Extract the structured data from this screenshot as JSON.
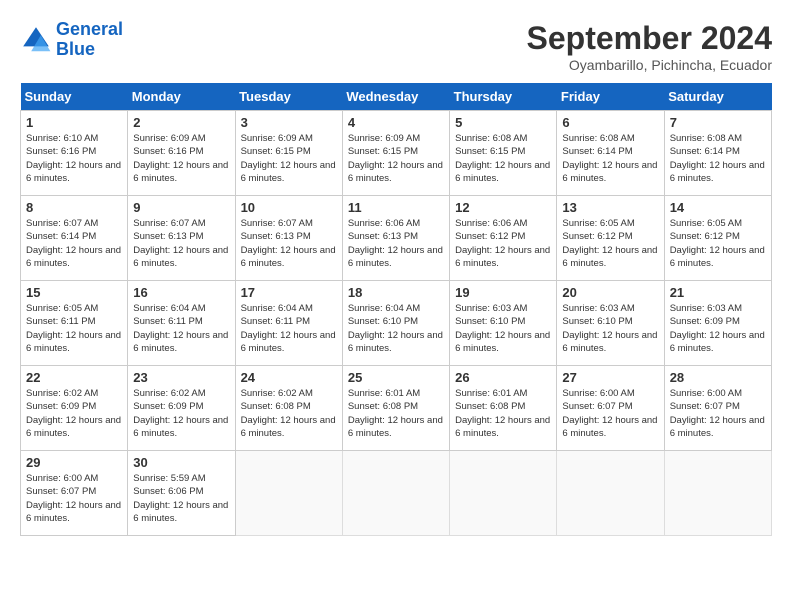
{
  "header": {
    "logo_line1": "General",
    "logo_line2": "Blue",
    "month_year": "September 2024",
    "location": "Oyambarillo, Pichincha, Ecuador"
  },
  "weekdays": [
    "Sunday",
    "Monday",
    "Tuesday",
    "Wednesday",
    "Thursday",
    "Friday",
    "Saturday"
  ],
  "weeks": [
    [
      {
        "day": "1",
        "sunrise": "6:10 AM",
        "sunset": "6:16 PM",
        "daylight": "12 hours and 6 minutes."
      },
      {
        "day": "2",
        "sunrise": "6:09 AM",
        "sunset": "6:16 PM",
        "daylight": "12 hours and 6 minutes."
      },
      {
        "day": "3",
        "sunrise": "6:09 AM",
        "sunset": "6:15 PM",
        "daylight": "12 hours and 6 minutes."
      },
      {
        "day": "4",
        "sunrise": "6:09 AM",
        "sunset": "6:15 PM",
        "daylight": "12 hours and 6 minutes."
      },
      {
        "day": "5",
        "sunrise": "6:08 AM",
        "sunset": "6:15 PM",
        "daylight": "12 hours and 6 minutes."
      },
      {
        "day": "6",
        "sunrise": "6:08 AM",
        "sunset": "6:14 PM",
        "daylight": "12 hours and 6 minutes."
      },
      {
        "day": "7",
        "sunrise": "6:08 AM",
        "sunset": "6:14 PM",
        "daylight": "12 hours and 6 minutes."
      }
    ],
    [
      {
        "day": "8",
        "sunrise": "6:07 AM",
        "sunset": "6:14 PM",
        "daylight": "12 hours and 6 minutes."
      },
      {
        "day": "9",
        "sunrise": "6:07 AM",
        "sunset": "6:13 PM",
        "daylight": "12 hours and 6 minutes."
      },
      {
        "day": "10",
        "sunrise": "6:07 AM",
        "sunset": "6:13 PM",
        "daylight": "12 hours and 6 minutes."
      },
      {
        "day": "11",
        "sunrise": "6:06 AM",
        "sunset": "6:13 PM",
        "daylight": "12 hours and 6 minutes."
      },
      {
        "day": "12",
        "sunrise": "6:06 AM",
        "sunset": "6:12 PM",
        "daylight": "12 hours and 6 minutes."
      },
      {
        "day": "13",
        "sunrise": "6:05 AM",
        "sunset": "6:12 PM",
        "daylight": "12 hours and 6 minutes."
      },
      {
        "day": "14",
        "sunrise": "6:05 AM",
        "sunset": "6:12 PM",
        "daylight": "12 hours and 6 minutes."
      }
    ],
    [
      {
        "day": "15",
        "sunrise": "6:05 AM",
        "sunset": "6:11 PM",
        "daylight": "12 hours and 6 minutes."
      },
      {
        "day": "16",
        "sunrise": "6:04 AM",
        "sunset": "6:11 PM",
        "daylight": "12 hours and 6 minutes."
      },
      {
        "day": "17",
        "sunrise": "6:04 AM",
        "sunset": "6:11 PM",
        "daylight": "12 hours and 6 minutes."
      },
      {
        "day": "18",
        "sunrise": "6:04 AM",
        "sunset": "6:10 PM",
        "daylight": "12 hours and 6 minutes."
      },
      {
        "day": "19",
        "sunrise": "6:03 AM",
        "sunset": "6:10 PM",
        "daylight": "12 hours and 6 minutes."
      },
      {
        "day": "20",
        "sunrise": "6:03 AM",
        "sunset": "6:10 PM",
        "daylight": "12 hours and 6 minutes."
      },
      {
        "day": "21",
        "sunrise": "6:03 AM",
        "sunset": "6:09 PM",
        "daylight": "12 hours and 6 minutes."
      }
    ],
    [
      {
        "day": "22",
        "sunrise": "6:02 AM",
        "sunset": "6:09 PM",
        "daylight": "12 hours and 6 minutes."
      },
      {
        "day": "23",
        "sunrise": "6:02 AM",
        "sunset": "6:09 PM",
        "daylight": "12 hours and 6 minutes."
      },
      {
        "day": "24",
        "sunrise": "6:02 AM",
        "sunset": "6:08 PM",
        "daylight": "12 hours and 6 minutes."
      },
      {
        "day": "25",
        "sunrise": "6:01 AM",
        "sunset": "6:08 PM",
        "daylight": "12 hours and 6 minutes."
      },
      {
        "day": "26",
        "sunrise": "6:01 AM",
        "sunset": "6:08 PM",
        "daylight": "12 hours and 6 minutes."
      },
      {
        "day": "27",
        "sunrise": "6:00 AM",
        "sunset": "6:07 PM",
        "daylight": "12 hours and 6 minutes."
      },
      {
        "day": "28",
        "sunrise": "6:00 AM",
        "sunset": "6:07 PM",
        "daylight": "12 hours and 6 minutes."
      }
    ],
    [
      {
        "day": "29",
        "sunrise": "6:00 AM",
        "sunset": "6:07 PM",
        "daylight": "12 hours and 6 minutes."
      },
      {
        "day": "30",
        "sunrise": "5:59 AM",
        "sunset": "6:06 PM",
        "daylight": "12 hours and 6 minutes."
      },
      null,
      null,
      null,
      null,
      null
    ]
  ]
}
